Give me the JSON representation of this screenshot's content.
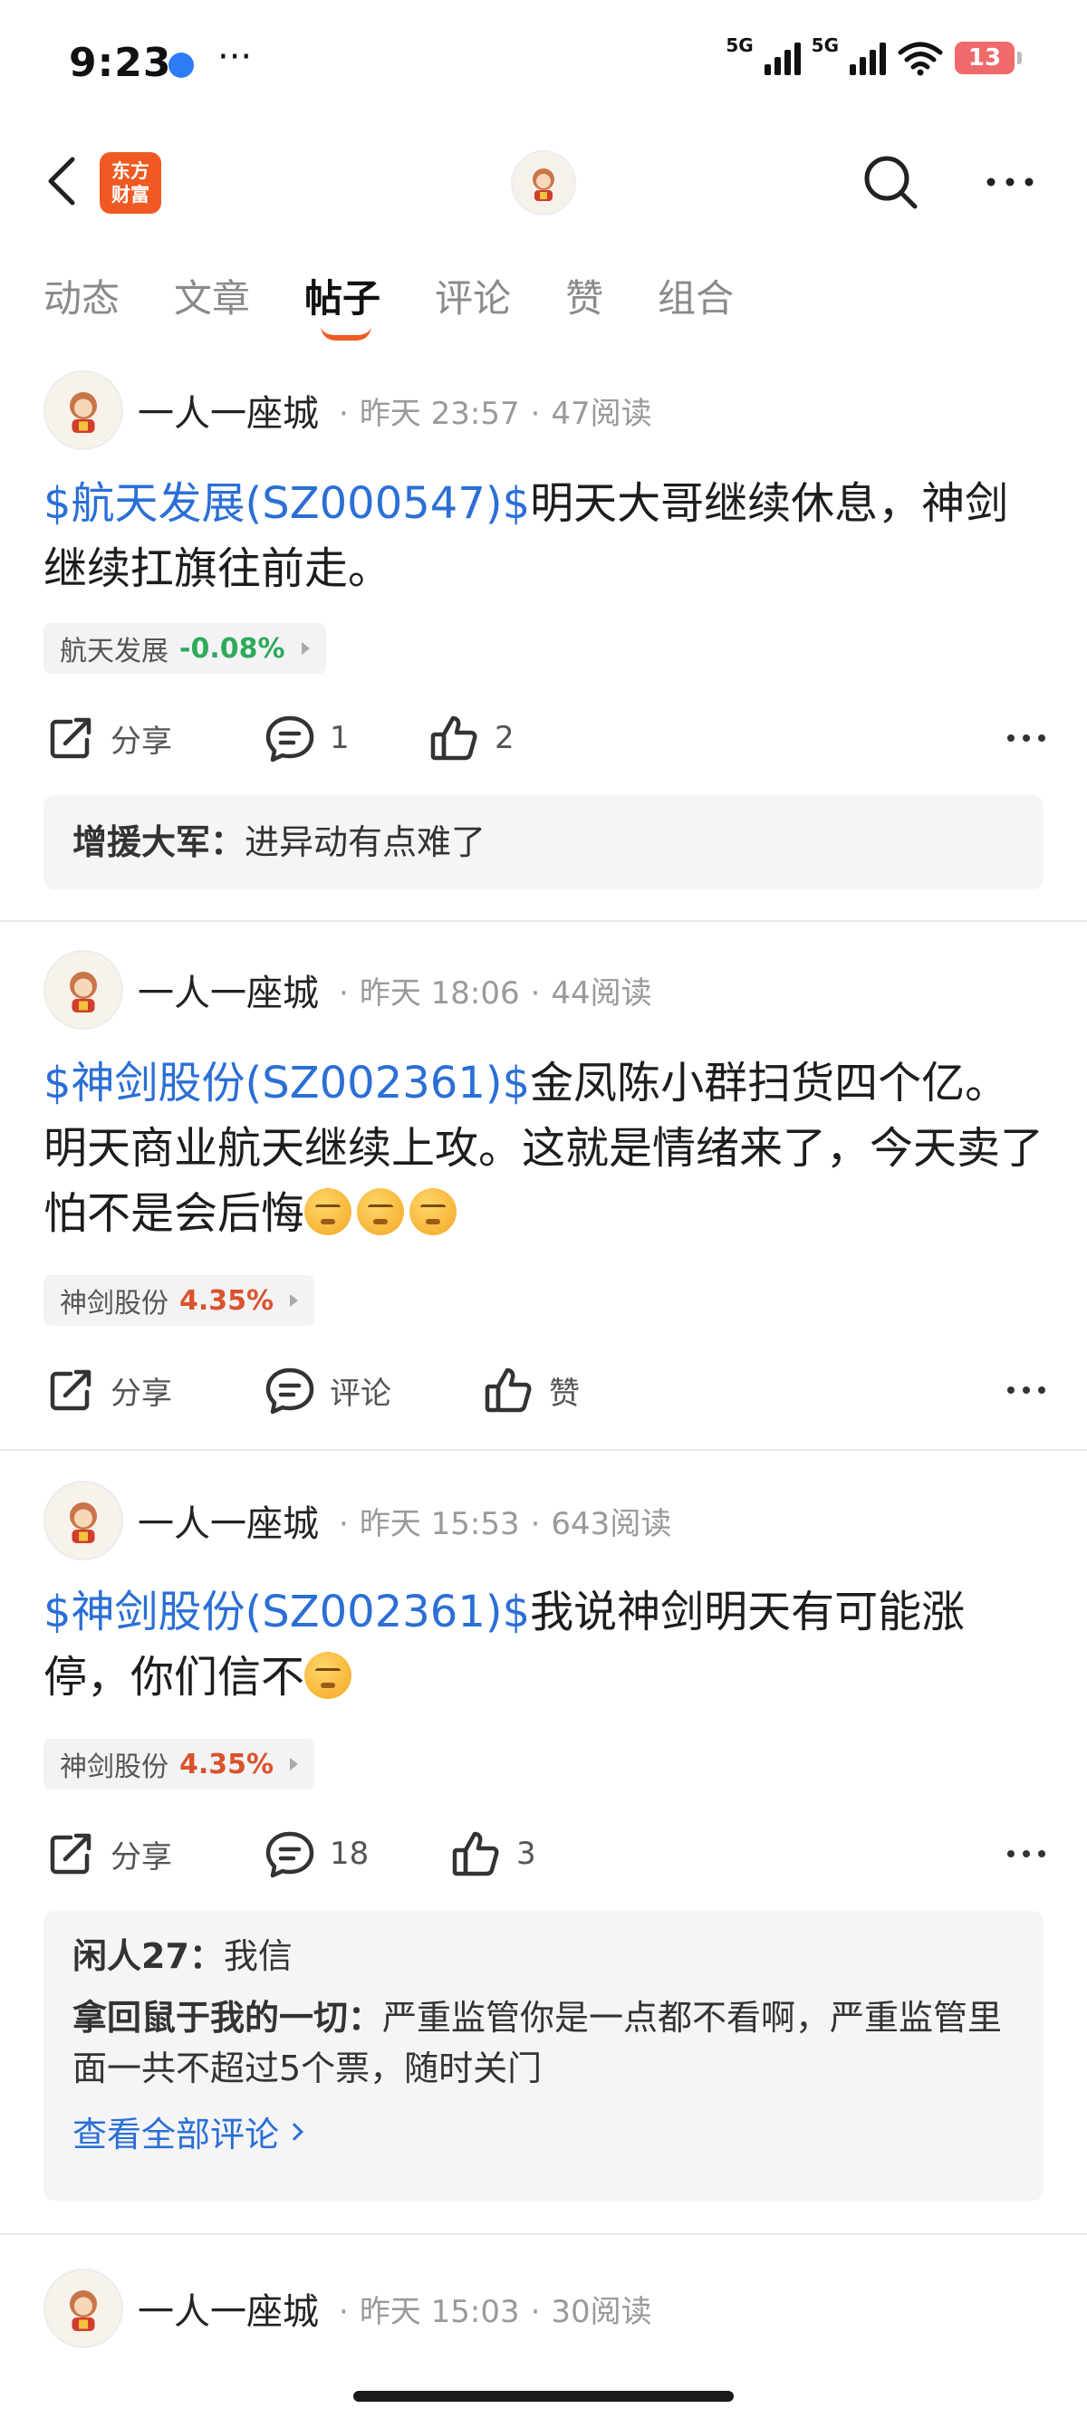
{
  "status_bar": {
    "time": "9:23",
    "more": "···",
    "net1": "5G",
    "net2": "5G",
    "battery": "13"
  },
  "nav": {
    "brand_line1": "东方",
    "brand_line2": "财富",
    "icons": [
      "back-icon",
      "search-icon",
      "more-icon"
    ]
  },
  "tabs": [
    {
      "label": "动态"
    },
    {
      "label": "文章"
    },
    {
      "label": "帖子"
    },
    {
      "label": "评论"
    },
    {
      "label": "赞"
    },
    {
      "label": "组合"
    }
  ],
  "active_tab": "帖子",
  "posts": [
    {
      "author": "一人一座城",
      "time": "昨天 23:57",
      "reads": "47阅读",
      "stock_tag": "$航天发展(SZ000547)$",
      "text": "明天大哥继续休息，神剑继续扛旗往前走。",
      "chip_name": "航天发展",
      "chip_change": "-0.08%",
      "share": "分享",
      "comments": "1",
      "likes": "2",
      "replies": [
        {
          "user": "增援大军：",
          "text": "进异动有点难了"
        }
      ]
    },
    {
      "author": "一人一座城",
      "time": "昨天 18:06",
      "reads": "44阅读",
      "stock_tag": "$神剑股份(SZ002361)$",
      "text": "金凤陈小群扫货四个亿。明天商业航天继续上攻。这就是情绪来了，今天卖了怕不是会后悔",
      "chip_name": "神剑股份",
      "chip_change": "4.35%",
      "share": "分享",
      "comments": "评论",
      "likes": "赞"
    },
    {
      "author": "一人一座城",
      "time": "昨天 15:53",
      "reads": "643阅读",
      "stock_tag": "$神剑股份(SZ002361)$",
      "text": "我说神剑明天有可能涨停，你们信不",
      "chip_name": "神剑股份",
      "chip_change": "4.35%",
      "share": "分享",
      "comments": "18",
      "likes": "3",
      "replies": [
        {
          "user": "闲人27：",
          "text": "我信"
        },
        {
          "user": "拿回鼠于我的一切：",
          "text": "严重监管你是一点都不看啊，严重监管里面一共不超过5个票，随时关门"
        }
      ],
      "view_all": "查看全部评论"
    },
    {
      "author": "一人一座城",
      "time": "昨天 15:03",
      "reads": "30阅读"
    }
  ],
  "colors": {
    "link_blue": "#2b6fd6",
    "brand_orange": "#f05a22",
    "down_green": "#2eaa5a",
    "up_red": "#d9532c"
  }
}
